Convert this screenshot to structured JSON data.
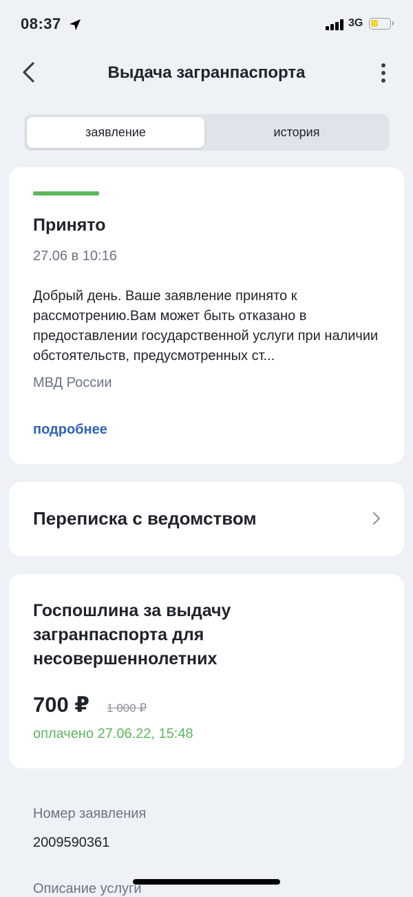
{
  "status_bar": {
    "time": "08:37",
    "network": "3G"
  },
  "header": {
    "title": "Выдача загранпаспорта"
  },
  "tabs": [
    {
      "label": "заявление",
      "active": true
    },
    {
      "label": "история",
      "active": false
    }
  ],
  "status_card": {
    "status": "Принято",
    "datetime": "27.06 в 10:16",
    "message": "Добрый день. Ваше заявление принято к рассмотрению.Вам может быть отказано в предоставлении государственной услуги при наличии обстоятельств, предусмотренных ст...",
    "organization": "МВД России",
    "more_link": "подробнее",
    "accent_color": "#5db85c"
  },
  "correspondence": {
    "label": "Переписка с ведомством"
  },
  "fee": {
    "title": "Госпошлина за выдачу загранпаспорта для несовершеннолетних",
    "price": "700 ₽",
    "old_price": "1 000 ₽",
    "paid_status": "оплачено 27.06.22, 15:48"
  },
  "details": {
    "application_number_label": "Номер заявления",
    "application_number": "2009590361",
    "service_description_label": "Описание услуги"
  }
}
